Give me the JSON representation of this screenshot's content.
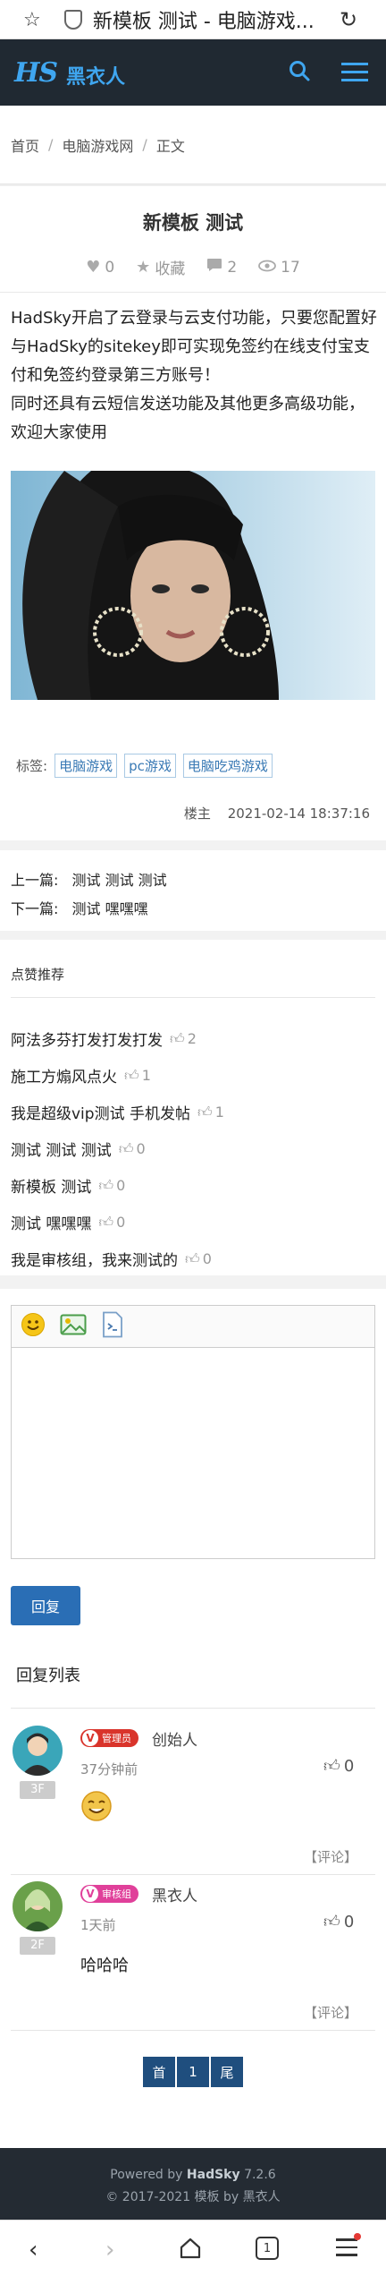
{
  "browser": {
    "title": "新模板 测试 - 电脑游戏...",
    "icons": [
      "star-icon",
      "shield-icon",
      "reload-icon"
    ]
  },
  "header": {
    "logo_mark": "HS",
    "logo_name": "黑衣人",
    "accent": "#3fa6f0",
    "background": "#202932"
  },
  "breadcrumb": [
    "首页",
    "电脑游戏网",
    "正文"
  ],
  "article": {
    "title": "新模板 测试",
    "likes": "0",
    "favorite_label": "收藏",
    "comments": "2",
    "views": "17",
    "body": [
      "HadSky开启了云登录与云支付功能，只要您配置好与HadSky的sitekey即可实现免签约在线支付宝支付和免签约登录第三方账号！",
      "同时还具有云短信发送功能及其他更多高级功能，欢迎大家使用"
    ],
    "tags_label": "标签:",
    "tags": [
      "电脑游戏",
      "pc游戏",
      "电脑吃鸡游戏"
    ],
    "author_label": "楼主",
    "date": "2021-02-14 18:37:16"
  },
  "prevnext": {
    "prev_label": "上一篇:",
    "prev_title": "测试 测试 测试",
    "next_label": "下一篇:",
    "next_title": "测试 嘿嘿嘿"
  },
  "liked": {
    "title": "点赞推荐",
    "items": [
      {
        "title": "阿法多芬打发打发打发",
        "count": "2"
      },
      {
        "title": "施工方煽风点火",
        "count": "1"
      },
      {
        "title": "我是超级vip测试 手机发帖",
        "count": "1"
      },
      {
        "title": "测试 测试 测试",
        "count": "0"
      },
      {
        "title": "新模板 测试",
        "count": "0"
      },
      {
        "title": "测试 嘿嘿嘿",
        "count": "0"
      },
      {
        "title": "我是审核组，我来测试的",
        "count": "0"
      }
    ]
  },
  "editor": {
    "toolbar": [
      "emoji-icon",
      "image-icon",
      "code-icon"
    ],
    "reply_button": "回复"
  },
  "comments": {
    "title": "回复列表",
    "items": [
      {
        "floor": "3F",
        "badge": "管理员",
        "badge_color": "#d9342b",
        "name": "创始人",
        "time": "37分钟前",
        "likes": "0",
        "content_icon": "smile-emoji-icon",
        "reply_label": "【评论】"
      },
      {
        "floor": "2F",
        "badge": "审核组",
        "badge_color": "#e0409a",
        "name": "黑衣人",
        "time": "1天前",
        "likes": "0",
        "content": "哈哈哈",
        "reply_label": "【评论】"
      }
    ],
    "pager": [
      "首",
      "1",
      "尾"
    ]
  },
  "footer": {
    "powered_prefix": "Powered by",
    "powered_name": "HadSky",
    "version": "7.2.6",
    "copyright_prefix": "© 2017-2021 模板 by",
    "copyright_name": "黑衣人"
  },
  "navbar": {
    "icons": [
      "back-icon",
      "forward-icon",
      "home-icon",
      "tabs-icon",
      "menu-icon"
    ],
    "tabs_count": "1"
  }
}
